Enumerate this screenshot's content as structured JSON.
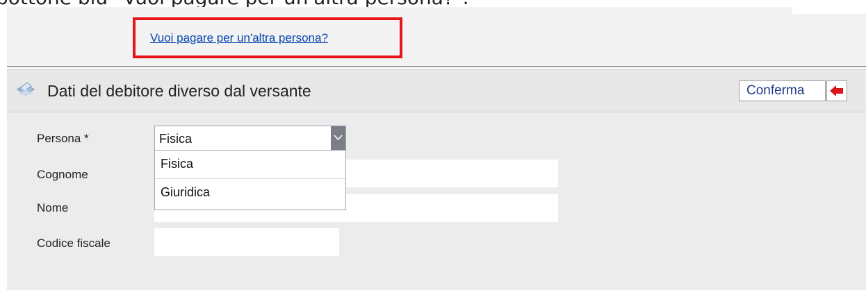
{
  "top_caption": "bottone blu \"Vuoi pagare per un'altra persona?\".",
  "highlight_link": "Vuoi pagare per un'altra persona?",
  "section": {
    "title": "Dati del debitore diverso dal versante",
    "confirm_label": "Conferma"
  },
  "form": {
    "persona_label": "Persona *",
    "persona_value": "Fisica",
    "cognome_label": "Cognome",
    "nome_label": "Nome",
    "codice_fiscale_label": "Codice fiscale"
  },
  "dropdown": {
    "options": [
      "Fisica",
      "Giuridica"
    ]
  },
  "colors": {
    "highlight": "#e8151b",
    "link": "#0645ad",
    "confirm_text": "#1f3c88",
    "back_arrow": "#d9141b"
  }
}
